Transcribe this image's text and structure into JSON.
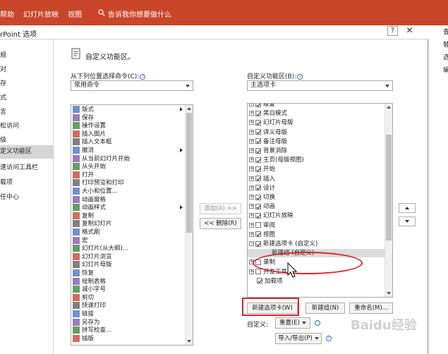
{
  "ribbon": {
    "tabs": [
      "帮助",
      "幻灯片放映",
      "视图"
    ],
    "search_placeholder": "告诉我你想要做什么",
    "bg_color": "#c9452a"
  },
  "dialog": {
    "title": "rPoint 选项",
    "help_label": "?",
    "close_label": "✕"
  },
  "nav": {
    "items": [
      "规",
      "对",
      "存",
      "式",
      "言",
      "松访问",
      "级",
      "定义功能区",
      "速访问工具栏",
      "载项",
      "任中心"
    ],
    "active_index": 7
  },
  "main": {
    "section_title": "自定义功能区。",
    "choose_label": "从下列位置选择命令(C):",
    "choose_value": "常用命令",
    "customize_label": "自定义功能区(B):",
    "customize_value": "主选项卡",
    "commands": [
      {
        "label": "版式",
        "icon": "layout-icon",
        "submenu": true
      },
      {
        "label": "保存",
        "icon": "save-icon",
        "submenu": false
      },
      {
        "label": "操作设置",
        "icon": "star-icon",
        "submenu": false
      },
      {
        "label": "插入图片",
        "icon": "picture-icon",
        "submenu": false
      },
      {
        "label": "插入文本框",
        "icon": "textbox-icon",
        "submenu": false
      },
      {
        "label": "撤消",
        "icon": "undo-icon",
        "submenu": true
      },
      {
        "label": "从当前幻灯片开始",
        "icon": "slideshow-current-icon",
        "submenu": false
      },
      {
        "label": "从头开始",
        "icon": "slideshow-start-icon",
        "submenu": false
      },
      {
        "label": "打开",
        "icon": "folder-icon",
        "submenu": false
      },
      {
        "label": "打印预览和打印",
        "icon": "print-preview-icon",
        "submenu": false
      },
      {
        "label": "大小和位置...",
        "icon": "size-icon",
        "submenu": false
      },
      {
        "label": "动画窗格",
        "icon": "animation-pane-icon",
        "submenu": false
      },
      {
        "label": "动画样式",
        "icon": "animation-star-icon",
        "submenu": true
      },
      {
        "label": "复制",
        "icon": "copy-icon",
        "submenu": false
      },
      {
        "label": "复制幻灯片",
        "icon": "duplicate-slide-icon",
        "submenu": false
      },
      {
        "label": "格式刷",
        "icon": "format-painter-icon",
        "submenu": false
      },
      {
        "label": "宏",
        "icon": "macro-icon",
        "submenu": false
      },
      {
        "label": "幻灯片(从大纲)...",
        "icon": "slide-outline-icon",
        "submenu": false
      },
      {
        "label": "幻灯片浏览",
        "icon": "slide-sorter-icon",
        "submenu": false
      },
      {
        "label": "幻灯片母版",
        "icon": "slide-master-icon",
        "submenu": false
      },
      {
        "label": "恢复",
        "icon": "redo-icon",
        "submenu": false
      },
      {
        "label": "绘制表格",
        "icon": "draw-table-icon",
        "submenu": false
      },
      {
        "label": "减小字号",
        "icon": "font-decrease-icon",
        "submenu": false
      },
      {
        "label": "剪切",
        "icon": "scissors-icon",
        "submenu": false
      },
      {
        "label": "快速打印",
        "icon": "quick-print-icon",
        "submenu": false
      },
      {
        "label": "链接",
        "icon": "link-icon",
        "submenu": false
      },
      {
        "label": "另存为",
        "icon": "save-as-icon",
        "submenu": false
      },
      {
        "label": "拼写检查...",
        "icon": "spellcheck-icon",
        "submenu": false
      },
      {
        "label": "插版",
        "icon": "generic-icon",
        "submenu": false
      }
    ],
    "tree": [
      {
        "label": "版复",
        "expand": "+",
        "checked": true,
        "indent": 0
      },
      {
        "label": "黑白模式",
        "expand": "+",
        "checked": true,
        "indent": 0
      },
      {
        "label": "幻灯片母版",
        "expand": "+",
        "checked": true,
        "indent": 0
      },
      {
        "label": "讲义母版",
        "expand": "+",
        "checked": true,
        "indent": 0
      },
      {
        "label": "备注母版",
        "expand": "+",
        "checked": true,
        "indent": 0
      },
      {
        "label": "背景消除",
        "expand": "+",
        "checked": true,
        "indent": 0
      },
      {
        "label": "主页(母版视图)",
        "expand": "+",
        "checked": true,
        "indent": 0
      },
      {
        "label": "开始",
        "expand": "+",
        "checked": true,
        "indent": 0
      },
      {
        "label": "插入",
        "expand": "+",
        "checked": true,
        "indent": 0
      },
      {
        "label": "设计",
        "expand": "+",
        "checked": true,
        "indent": 0
      },
      {
        "label": "切换",
        "expand": "+",
        "checked": true,
        "indent": 0
      },
      {
        "label": "动画",
        "expand": "+",
        "checked": true,
        "indent": 0
      },
      {
        "label": "幻灯片放映",
        "expand": "+",
        "checked": true,
        "indent": 0
      },
      {
        "label": "审阅",
        "expand": "+",
        "checked": false,
        "indent": 0
      },
      {
        "label": "视图",
        "expand": "+",
        "checked": true,
        "indent": 0
      },
      {
        "label": "新建选项卡 (自定义)",
        "expand": "−",
        "checked": true,
        "indent": 0
      },
      {
        "label": "新建组 (自定义)",
        "expand": "",
        "checked": null,
        "indent": 1,
        "selected": true
      },
      {
        "label": "录制",
        "expand": "+",
        "checked": false,
        "indent": 0
      },
      {
        "label": "开发工具",
        "expand": "+",
        "checked": false,
        "indent": 0
      },
      {
        "label": "加载项",
        "expand": "",
        "checked": true,
        "indent": 0
      }
    ],
    "add_label": "添加(A) >>",
    "remove_label": "<< 删除(R)",
    "new_tab_label": "新建选项卡(W)",
    "new_group_label": "新建组(N)",
    "rename_label": "重命名(M)...",
    "customize_short_label": "自定义:",
    "reset_label": "重置(E)",
    "import_export_label": "导入/导出(P)"
  },
  "right_window": {
    "items": [
      "查",
      "替",
      "选",
      "编"
    ]
  },
  "watermark": "Baidu经验",
  "annotation_color": "#e0262b"
}
